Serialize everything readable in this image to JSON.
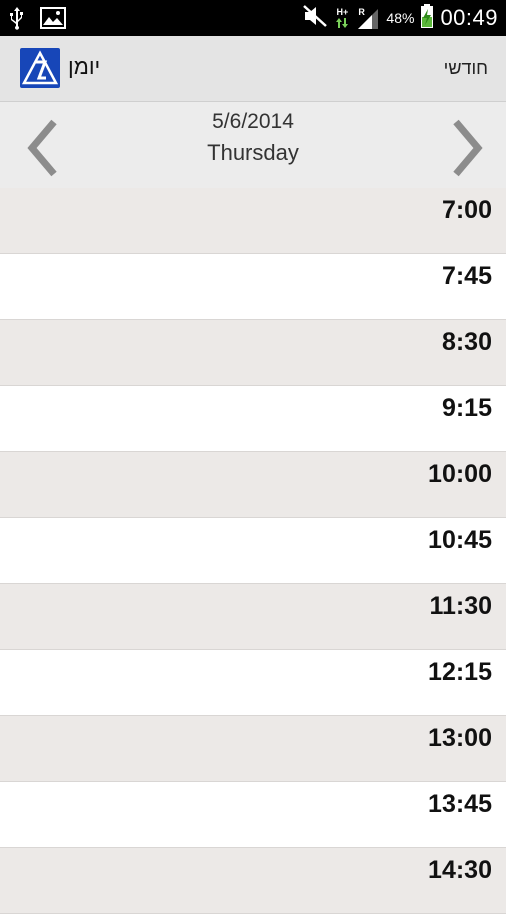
{
  "status_bar": {
    "icons": [
      "usb-icon",
      "image-icon",
      "mute-icon",
      "signal-icon",
      "battery-icon"
    ],
    "network_type": "H+",
    "roaming": "R",
    "battery": "48%",
    "time": "00:49"
  },
  "action_bar": {
    "title": "יומן",
    "monthly_label": "חודשי",
    "logo_color": "#1746b8"
  },
  "date_header": {
    "date": "5/6/2014",
    "weekday": "Thursday"
  },
  "schedule": {
    "slots": [
      "7:00",
      "7:45",
      "8:30",
      "9:15",
      "10:00",
      "10:45",
      "11:30",
      "12:15",
      "13:00",
      "13:45",
      "14:30"
    ]
  },
  "colors": {
    "shaded_row": "#ece9e7",
    "plain_row": "#ffffff"
  }
}
